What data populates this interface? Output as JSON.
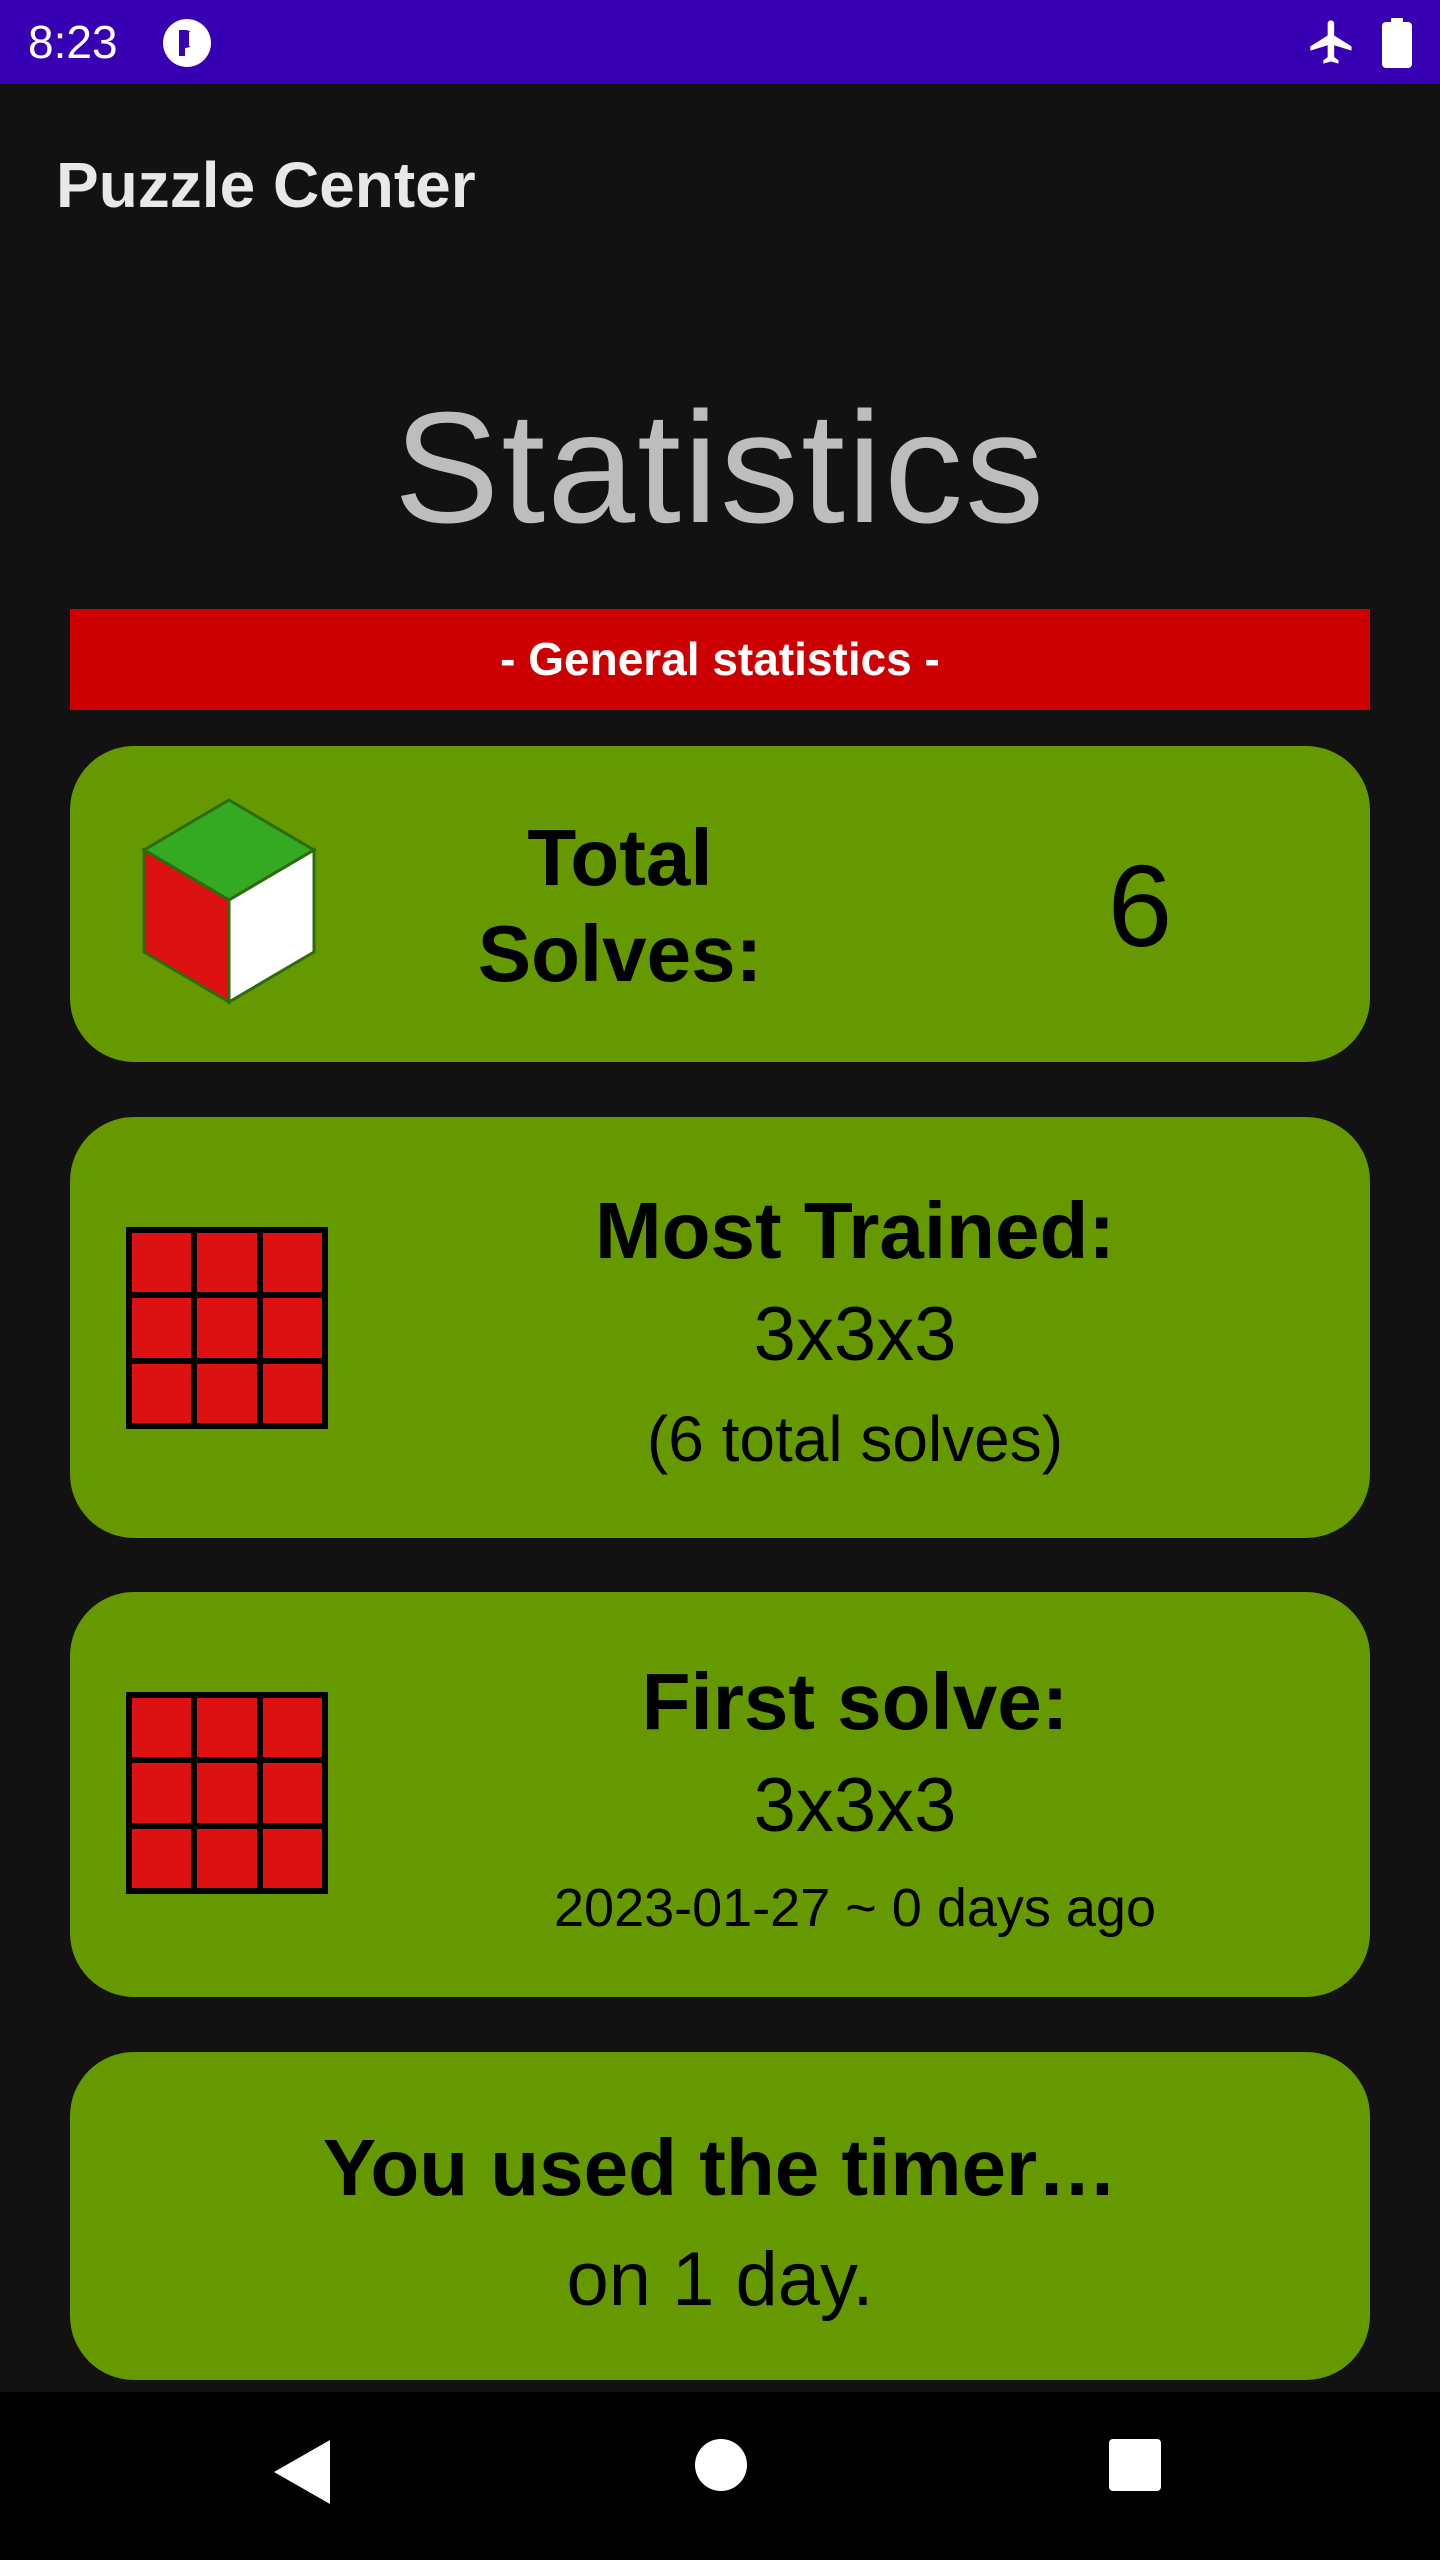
{
  "status_bar": {
    "time": "8:23",
    "icons": [
      "app-notification-icon",
      "airplane-mode-icon",
      "battery-icon"
    ],
    "background": "#3700b3"
  },
  "app_bar": {
    "title": "Puzzle Center"
  },
  "page": {
    "heading": "Statistics"
  },
  "section": {
    "label": "- General statistics -",
    "color": "#cc0000"
  },
  "cards": {
    "total_solves": {
      "label": "Total Solves:",
      "value": "6",
      "icon": "cube-icon"
    },
    "most_trained": {
      "title": "Most Trained:",
      "puzzle": "3x3x3",
      "detail": "(6 total solves)",
      "icon": "grid-3x3-icon"
    },
    "first_solve": {
      "title": "First solve:",
      "puzzle": "3x3x3",
      "detail": "2023-01-27 ~ 0 days ago",
      "icon": "grid-3x3-icon"
    },
    "timer_days": {
      "title": "You used the timer…",
      "detail": "on 1 day."
    },
    "color": "#669900"
  },
  "nav_bar": {
    "icons": [
      "back-icon",
      "home-icon",
      "recents-icon"
    ]
  }
}
